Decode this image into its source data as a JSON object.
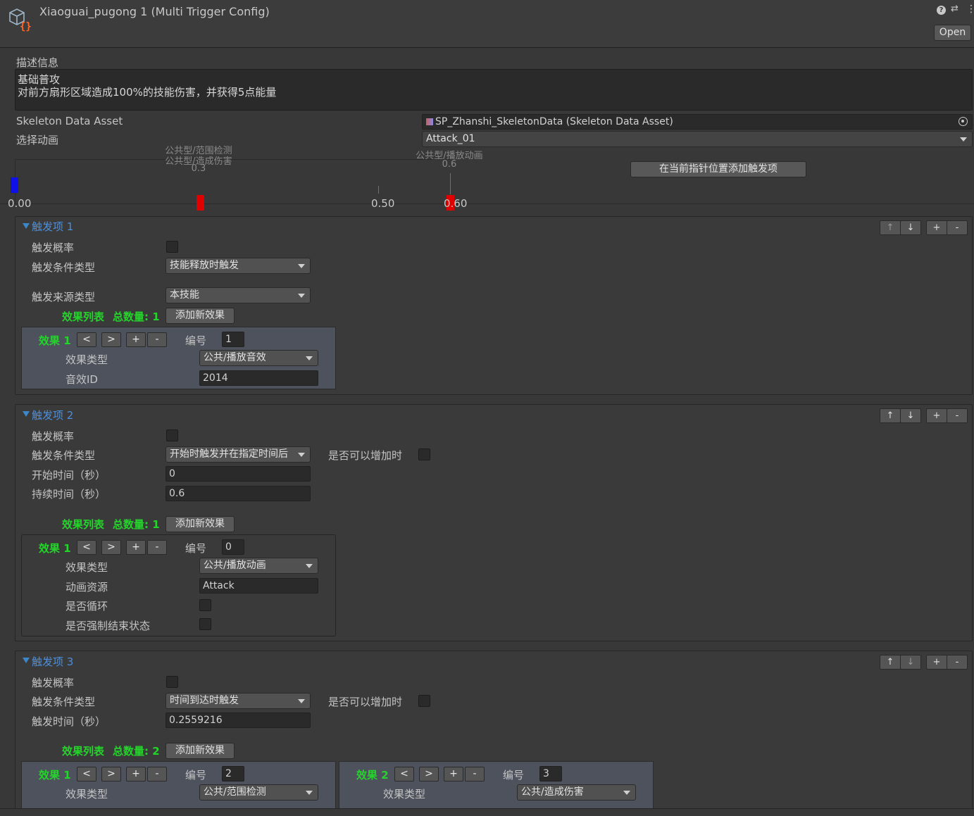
{
  "header": {
    "title": "Xiaoguai_pugong 1 (Multi Trigger Config)",
    "open_label": "Open",
    "help_icon": "?",
    "settings_icon": "⇄",
    "menu_icon": "⋮"
  },
  "desc": {
    "label": "描述信息",
    "line1": "基础普攻",
    "line2": "对前方扇形区域造成100%的技能伤害，并获得5点能量"
  },
  "skeleton": {
    "label": "Skeleton Data Asset",
    "value": "SP_Zhanshi_SkeletonData (Skeleton Data Asset)"
  },
  "anim": {
    "label": "选择动画",
    "value": "Attack_01"
  },
  "timeline": {
    "marker1_label_a": "公共型/范围检测",
    "marker1_label_b": "公共型/造成伤害",
    "marker1_time": "0.3",
    "marker2_label": "公共型/播放动画",
    "marker2_time": "0.6",
    "tick_start": "0.00",
    "tick_mid": "0.50",
    "tick_end": "0.60",
    "add_button": "在当前指针位置添加触发项",
    "marker_color": "#e00000",
    "cursor_color": "#1010e8"
  },
  "t1": {
    "title": "触发项 1",
    "prob_label": "触发概率",
    "cond_label": "触发条件类型",
    "cond_value": "技能释放时触发",
    "src_label": "触发来源类型",
    "src_value": "本技能",
    "list_label": "效果列表",
    "total_label": "总数量: 1",
    "add_label": "添加新效果",
    "e1": {
      "title": "效果 1",
      "prev": "<",
      "next": ">",
      "plus": "+",
      "minus": "-",
      "num_label": "编号",
      "num_value": "1",
      "type_label": "效果类型",
      "type_value": "公共/播放音效",
      "f_label": "音效ID",
      "f_value": "2014"
    }
  },
  "t2": {
    "title": "触发项 2",
    "prob_label": "触发概率",
    "cond_label": "触发条件类型",
    "cond_value": "开始时触发并在指定时间后",
    "inc_label": "是否可以增加时",
    "start_label": "开始时间（秒）",
    "start_value": "0",
    "dur_label": "持续时间（秒）",
    "dur_value": "0.6",
    "list_label": "效果列表",
    "total_label": "总数量: 1",
    "add_label": "添加新效果",
    "e1": {
      "title": "效果 1",
      "prev": "<",
      "next": ">",
      "plus": "+",
      "minus": "-",
      "num_label": "编号",
      "num_value": "0",
      "type_label": "效果类型",
      "type_value": "公共/播放动画",
      "res_label": "动画资源",
      "res_value": "Attack",
      "loop_label": "是否循环",
      "force_label": "是否强制结束状态"
    }
  },
  "t3": {
    "title": "触发项 3",
    "prob_label": "触发概率",
    "cond_label": "触发条件类型",
    "cond_value": "时间到达时触发",
    "inc_label": "是否可以增加时",
    "time_label": "触发时间（秒）",
    "time_value": "0.2559216",
    "list_label": "效果列表",
    "total_label": "总数量: 2",
    "add_label": "添加新效果",
    "e1": {
      "title": "效果 1",
      "prev": "<",
      "next": ">",
      "plus": "+",
      "minus": "-",
      "num_label": "编号",
      "num_value": "2",
      "type_label": "效果类型",
      "type_value": "公共/范围检测"
    },
    "e2": {
      "title": "效果 2",
      "prev": "<",
      "next": ">",
      "plus": "+",
      "minus": "-",
      "num_label": "编号",
      "num_value": "3",
      "type_label": "效果类型",
      "type_value": "公共/造成伤害"
    }
  },
  "section_buttons": {
    "up": "↑",
    "down": "↓",
    "plus": "+",
    "minus": "-"
  }
}
